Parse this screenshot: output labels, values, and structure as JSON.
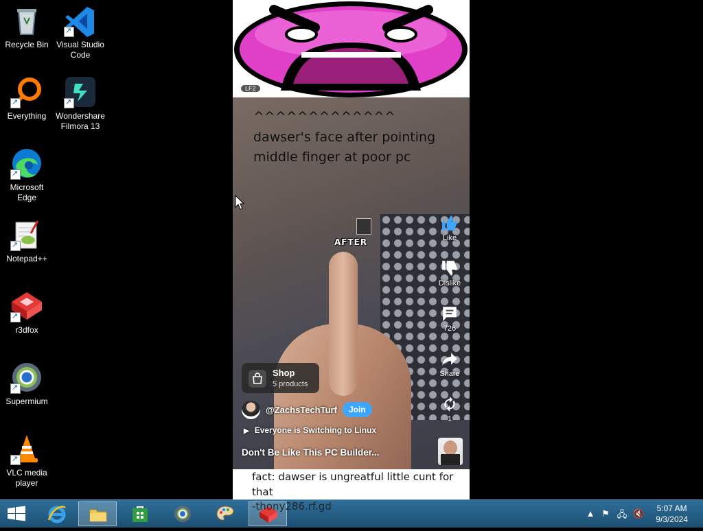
{
  "desktop": {
    "icons": [
      {
        "label": "Recycle Bin",
        "icon": "recycle-bin-icon"
      },
      {
        "label": "Visual Studio\nCode",
        "icon": "vscode-icon"
      },
      {
        "label": "Everything",
        "icon": "everything-search-icon"
      },
      {
        "label": "Wondershare\nFilmora 13",
        "icon": "filmora-icon"
      },
      {
        "label": "Microsoft\nEdge",
        "icon": "edge-icon"
      },
      {
        "label": "Notepad++",
        "icon": "notepadpp-icon"
      },
      {
        "label": "r3dfox",
        "icon": "r3dfox-icon"
      },
      {
        "label": "Supermium",
        "icon": "supermium-icon"
      },
      {
        "label": "VLC media\nplayer",
        "icon": "vlc-icon"
      }
    ]
  },
  "image": {
    "face_badge": "LF2",
    "caption_arrows": "^^^^^^^^^^^^^",
    "caption_line1": "dawser's face after pointing",
    "caption_line2": "middle finger at poor pc",
    "after_label": "AFTER",
    "actions": {
      "like": "Like",
      "dislike": "Dislike",
      "comments": "726",
      "share": "Share",
      "remix": "1"
    },
    "shop": {
      "title": "Shop",
      "subtitle": "5 products"
    },
    "channel": {
      "name": "@ZachsTechTurf",
      "join": "Join"
    },
    "playlist": "Everyone is Switching to Linux",
    "video_title": "Don't Be Like This PC Builder...",
    "bottom_caption_line1": "fact: dawser is ungreatful little cunt for",
    "bottom_caption_line2": "that",
    "bottom_url": "-thony286.rf.gd"
  },
  "taskbar": {
    "buttons": [
      {
        "name": "internet-explorer",
        "active": false
      },
      {
        "name": "file-explorer",
        "active": true
      },
      {
        "name": "store",
        "active": false
      },
      {
        "name": "supermium",
        "active": false
      },
      {
        "name": "paint",
        "active": false
      },
      {
        "name": "r3dfox",
        "active": true
      }
    ],
    "clock": {
      "time": "5:07 AM",
      "date": "9/3/2024"
    }
  },
  "colors": {
    "taskbar": "#2f6f99",
    "join_button": "#3ea6ff",
    "meme_face": "#e040c8",
    "like_blue": "#3ea6ff"
  }
}
